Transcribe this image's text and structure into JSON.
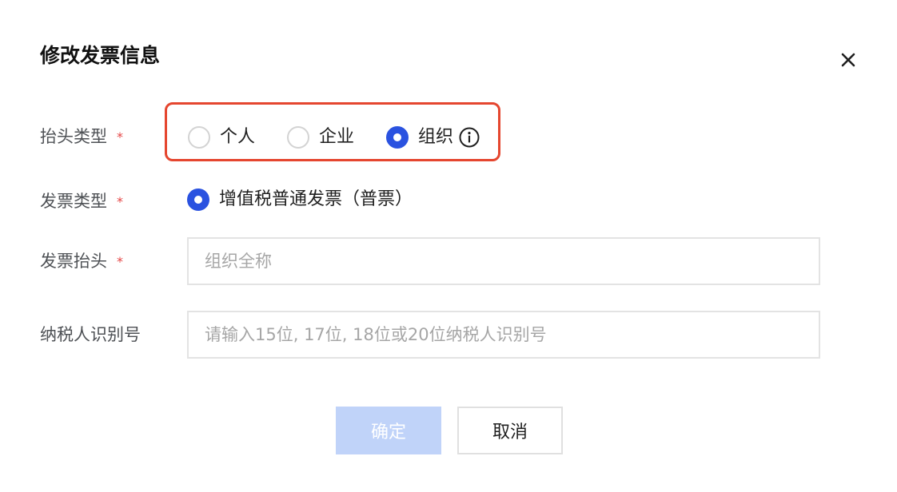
{
  "dialog": {
    "title": "修改发票信息",
    "close_icon": "close-icon"
  },
  "form": {
    "title_type": {
      "label": "抬头类型",
      "required_mark": "*",
      "options": [
        {
          "label": "个人",
          "checked": false
        },
        {
          "label": "企业",
          "checked": false
        },
        {
          "label": "组织",
          "checked": true
        }
      ],
      "info_icon": "info-icon",
      "highlight_color": "#e5462f"
    },
    "invoice_type": {
      "label": "发票类型",
      "required_mark": "*",
      "option": {
        "label": "增值税普通发票（普票）",
        "checked": true
      }
    },
    "invoice_title": {
      "label": "发票抬头",
      "required_mark": "*",
      "value": "",
      "placeholder": "组织全称"
    },
    "tax_id": {
      "label": "纳税人识别号",
      "value": "",
      "placeholder": "请输入15位, 17位, 18位或20位纳税人识别号"
    }
  },
  "buttons": {
    "confirm": "确定",
    "cancel": "取消"
  },
  "colors": {
    "accent": "#2a52e0",
    "confirm_disabled_bg": "#c0d3f9",
    "required": "#e54545"
  }
}
